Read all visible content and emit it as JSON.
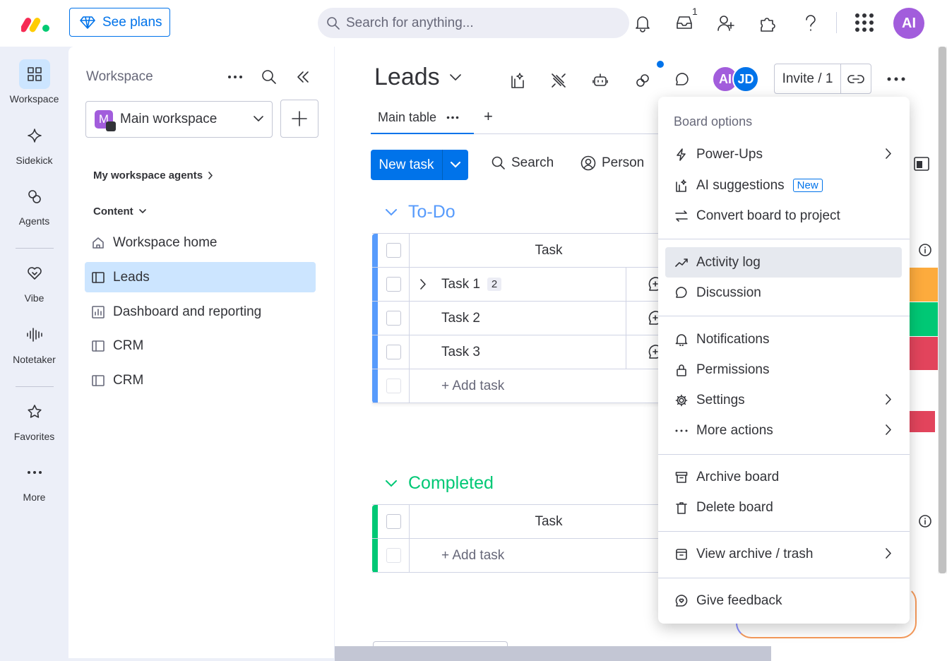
{
  "topbar": {
    "see_plans": "See plans",
    "search_placeholder": "Search for anything...",
    "inbox_badge": "1",
    "avatar": "AI"
  },
  "rail": {
    "items": [
      {
        "label": "Workspace",
        "icon": "grid-icon"
      },
      {
        "label": "Sidekick",
        "icon": "sparkle-icon"
      },
      {
        "label": "Agents",
        "icon": "agents-icon"
      },
      {
        "label": "Vibe",
        "icon": "heart-icon"
      },
      {
        "label": "Notetaker",
        "icon": "waveform-icon"
      },
      {
        "label": "Favorites",
        "icon": "star-icon"
      },
      {
        "label": "More",
        "icon": "more-dots-icon"
      }
    ]
  },
  "sidebar": {
    "title": "Workspace",
    "workspace_letter": "M",
    "workspace_name": "Main workspace",
    "agents_label": "My workspace agents",
    "content_label": "Content",
    "items": [
      {
        "label": "Workspace home"
      },
      {
        "label": "Leads"
      },
      {
        "label": "Dashboard and reporting"
      },
      {
        "label": "CRM"
      },
      {
        "label": "CRM"
      }
    ]
  },
  "board": {
    "title": "Leads",
    "avatars": [
      "AI",
      "JD"
    ],
    "invite_label": "Invite / 1",
    "tab_main": "Main table",
    "tab_add": "+",
    "new_task": "New task",
    "filter_search": "Search",
    "filter_person": "Person",
    "groups": [
      {
        "title": "To-Do",
        "color": "#579bfc",
        "column": "Task",
        "rows": [
          {
            "name": "Task 1",
            "count": "2"
          },
          {
            "name": "Task 2"
          },
          {
            "name": "Task 3"
          }
        ],
        "add_task": "+ Add task"
      },
      {
        "title": "Completed",
        "color": "#00c875",
        "column": "Task",
        "add_task": "+ Add task"
      }
    ]
  },
  "menu": {
    "header": "Board options",
    "items": {
      "power_ups": "Power-Ups",
      "ai_suggestions": "AI suggestions",
      "new_tag": "New",
      "convert": "Convert board to project",
      "activity_log": "Activity log",
      "discussion": "Discussion",
      "notifications": "Notifications",
      "permissions": "Permissions",
      "settings": "Settings",
      "more_actions": "More actions",
      "archive_board": "Archive board",
      "delete_board": "Delete board",
      "view_archive": "View archive / trash",
      "give_feedback": "Give feedback"
    }
  },
  "colors": {
    "accent": "#0073ea",
    "todo": "#579bfc",
    "completed": "#00c875",
    "status_orange": "#fdab3d",
    "status_green": "#00c875",
    "status_red": "#e2445c"
  }
}
